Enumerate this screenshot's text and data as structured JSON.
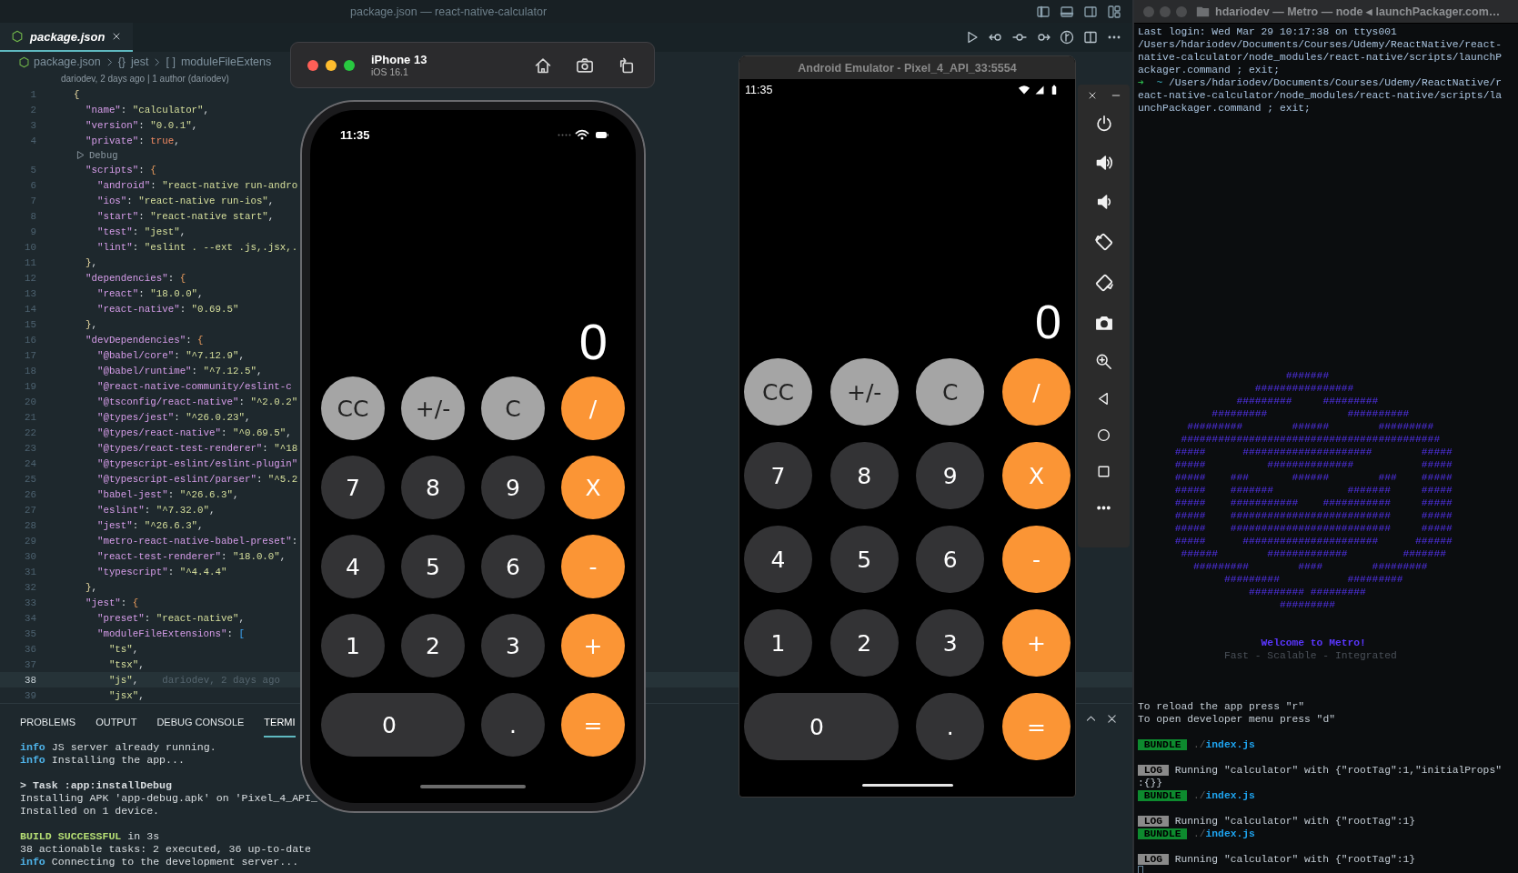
{
  "vscode": {
    "title": "package.json — react-native-calculator",
    "tab": {
      "label": "package.json"
    },
    "breadcrumb": [
      {
        "kind": "file",
        "label": "package.json"
      },
      {
        "kind": "object",
        "icon": "{}",
        "label": "jest"
      },
      {
        "kind": "array",
        "icon": "[ ]",
        "label": "moduleFileExtens"
      }
    ],
    "blame": "dariodev, 2 days ago | 1 author (dariodev)",
    "lines": [
      {
        "kind": "code",
        "number": "1",
        "text": "{",
        "current": false
      },
      {
        "kind": "code",
        "number": "2",
        "text": "  \"name\": \"calculator\",",
        "current": false
      },
      {
        "kind": "code",
        "number": "3",
        "text": "  \"version\": \"0.0.1\",",
        "current": false
      },
      {
        "kind": "code",
        "number": "4",
        "text": "  \"private\": true,",
        "current": false
      },
      {
        "kind": "codelens",
        "label": "Debug"
      },
      {
        "kind": "code",
        "number": "5",
        "text": "  \"scripts\": {",
        "current": false
      },
      {
        "kind": "code",
        "number": "6",
        "text": "    \"android\": \"react-native run-andro",
        "current": false
      },
      {
        "kind": "code",
        "number": "7",
        "text": "    \"ios\": \"react-native run-ios\",",
        "current": false
      },
      {
        "kind": "code",
        "number": "8",
        "text": "    \"start\": \"react-native start\",",
        "current": false
      },
      {
        "kind": "code",
        "number": "9",
        "text": "    \"test\": \"jest\",",
        "current": false
      },
      {
        "kind": "code",
        "number": "10",
        "text": "    \"lint\": \"eslint . --ext .js,.jsx,.",
        "current": false
      },
      {
        "kind": "code",
        "number": "11",
        "text": "  },",
        "current": false
      },
      {
        "kind": "code",
        "number": "12",
        "text": "  \"dependencies\": {",
        "current": false
      },
      {
        "kind": "code",
        "number": "13",
        "text": "    \"react\": \"18.0.0\",",
        "current": false
      },
      {
        "kind": "code",
        "number": "14",
        "text": "    \"react-native\": \"0.69.5\"",
        "current": false
      },
      {
        "kind": "code",
        "number": "15",
        "text": "  },",
        "current": false
      },
      {
        "kind": "code",
        "number": "16",
        "text": "  \"devDependencies\": {",
        "current": false
      },
      {
        "kind": "code",
        "number": "17",
        "text": "    \"@babel/core\": \"^7.12.9\",",
        "current": false
      },
      {
        "kind": "code",
        "number": "18",
        "text": "    \"@babel/runtime\": \"^7.12.5\",",
        "current": false
      },
      {
        "kind": "code",
        "number": "19",
        "text": "    \"@react-native-community/eslint-c",
        "current": false
      },
      {
        "kind": "code",
        "number": "20",
        "text": "    \"@tsconfig/react-native\": \"^2.0.2\"",
        "current": false
      },
      {
        "kind": "code",
        "number": "21",
        "text": "    \"@types/jest\": \"^26.0.23\",",
        "current": false
      },
      {
        "kind": "code",
        "number": "22",
        "text": "    \"@types/react-native\": \"^0.69.5\",",
        "current": false
      },
      {
        "kind": "code",
        "number": "23",
        "text": "    \"@types/react-test-renderer\": \"^18",
        "current": false
      },
      {
        "kind": "code",
        "number": "24",
        "text": "    \"@typescript-eslint/eslint-plugin\"",
        "current": false
      },
      {
        "kind": "code",
        "number": "25",
        "text": "    \"@typescript-eslint/parser\": \"^5.2",
        "current": false
      },
      {
        "kind": "code",
        "number": "26",
        "text": "    \"babel-jest\": \"^26.6.3\",",
        "current": false
      },
      {
        "kind": "code",
        "number": "27",
        "text": "    \"eslint\": \"^7.32.0\",",
        "current": false
      },
      {
        "kind": "code",
        "number": "28",
        "text": "    \"jest\": \"^26.6.3\",",
        "current": false
      },
      {
        "kind": "code",
        "number": "29",
        "text": "    \"metro-react-native-babel-preset\":",
        "current": false
      },
      {
        "kind": "code",
        "number": "30",
        "text": "    \"react-test-renderer\": \"18.0.0\",",
        "current": false
      },
      {
        "kind": "code",
        "number": "31",
        "text": "    \"typescript\": \"^4.4.4\"",
        "current": false
      },
      {
        "kind": "code",
        "number": "32",
        "text": "  },",
        "current": false
      },
      {
        "kind": "code",
        "number": "33",
        "text": "  \"jest\": {",
        "current": false
      },
      {
        "kind": "code",
        "number": "34",
        "text": "    \"preset\": \"react-native\",",
        "current": false
      },
      {
        "kind": "code",
        "number": "35",
        "text": "    \"moduleFileExtensions\": [",
        "current": false
      },
      {
        "kind": "code",
        "number": "36",
        "text": "      \"ts\",",
        "current": false
      },
      {
        "kind": "code",
        "number": "37",
        "text": "      \"tsx\",",
        "current": false
      },
      {
        "kind": "code",
        "number": "38",
        "text": "      \"js\",",
        "current": true,
        "blame": "dariodev, 2 days ago"
      },
      {
        "kind": "code",
        "number": "39",
        "text": "      \"jsx\",",
        "current": false
      }
    ],
    "panel": {
      "tabs": [
        {
          "label": "PROBLEMS",
          "selected": false
        },
        {
          "label": "OUTPUT",
          "selected": false
        },
        {
          "label": "DEBUG CONSOLE",
          "selected": false
        },
        {
          "label": "TERMI",
          "selected": true
        }
      ],
      "terminal": [
        [
          {
            "kind": "info",
            "label": "info",
            "text": "JS server already running."
          },
          {
            "kind": "info",
            "label": "info",
            "text": "Installing the app..."
          }
        ],
        [
          {
            "kind": "bold",
            "text": "> Task :app:installDebug"
          },
          {
            "kind": "plain",
            "text": "Installing APK 'app-debug.apk' on 'Pixel_4_API_"
          },
          {
            "kind": "plain",
            "text": "Installed on 1 device."
          }
        ],
        [
          {
            "kind": "success",
            "label": "BUILD SUCCESSFUL",
            "text": "in 3s"
          },
          {
            "kind": "plain",
            "text": "38 actionable tasks: 2 executed, 36 up-to-date"
          },
          {
            "kind": "info",
            "label": "info",
            "text": "Connecting to the development server..."
          }
        ]
      ]
    }
  },
  "ios_simulator": {
    "device": "iPhone 13",
    "os": "iOS 16.1",
    "status": {
      "time": "11:35"
    },
    "calculator": {
      "display": "0",
      "buttons": [
        {
          "kind": "function",
          "label": "CC"
        },
        {
          "kind": "function",
          "label": "+/-"
        },
        {
          "kind": "function",
          "label": "C"
        },
        {
          "kind": "operator",
          "label": "/"
        },
        {
          "kind": "digit",
          "label": "7"
        },
        {
          "kind": "digit",
          "label": "8"
        },
        {
          "kind": "digit",
          "label": "9"
        },
        {
          "kind": "operator",
          "label": "X"
        },
        {
          "kind": "digit",
          "label": "4"
        },
        {
          "kind": "digit",
          "label": "5"
        },
        {
          "kind": "digit",
          "label": "6"
        },
        {
          "kind": "operator",
          "label": "-"
        },
        {
          "kind": "digit",
          "label": "1"
        },
        {
          "kind": "digit",
          "label": "2"
        },
        {
          "kind": "digit",
          "label": "3"
        },
        {
          "kind": "operator",
          "label": "+"
        },
        {
          "kind": "wide",
          "label": "0"
        },
        {
          "kind": "digit",
          "label": "."
        },
        {
          "kind": "operator",
          "label": "="
        }
      ]
    }
  },
  "android_emulator": {
    "title": "Android Emulator - Pixel_4_API_33:5554",
    "status": {
      "time": "11:35"
    },
    "calculator": {
      "display": "0",
      "buttons": [
        {
          "kind": "function",
          "label": "CC"
        },
        {
          "kind": "function",
          "label": "+/-"
        },
        {
          "kind": "function",
          "label": "C"
        },
        {
          "kind": "operator",
          "label": "/"
        },
        {
          "kind": "digit",
          "label": "7"
        },
        {
          "kind": "digit",
          "label": "8"
        },
        {
          "kind": "digit",
          "label": "9"
        },
        {
          "kind": "operator",
          "label": "X"
        },
        {
          "kind": "digit",
          "label": "4"
        },
        {
          "kind": "digit",
          "label": "5"
        },
        {
          "kind": "digit",
          "label": "6"
        },
        {
          "kind": "operator",
          "label": "-"
        },
        {
          "kind": "digit",
          "label": "1"
        },
        {
          "kind": "digit",
          "label": "2"
        },
        {
          "kind": "digit",
          "label": "3"
        },
        {
          "kind": "operator",
          "label": "+"
        },
        {
          "kind": "wide",
          "label": "0"
        },
        {
          "kind": "digit",
          "label": "."
        },
        {
          "kind": "operator",
          "label": "="
        }
      ]
    }
  },
  "metro": {
    "title": "hdariodev — Metro — node ◂ launchPackager.com…",
    "login": [
      {
        "kind": "plain",
        "text": "Last login: Wed Mar 29 10:17:38 on ttys001"
      },
      {
        "kind": "plain",
        "text": "/Users/hdariodev/Documents/Courses/Udemy/ReactNative/react-"
      },
      {
        "kind": "plain",
        "text": "native-calculator/node_modules/react-native/scripts/launchP"
      },
      {
        "kind": "plain",
        "text": "ackager.command ; exit;"
      },
      {
        "kind": "prompt",
        "arrow": "➜",
        "cwd": "~",
        "text": "/Users/hdariodev/Documents/Courses/Udemy/ReactNative/r"
      },
      {
        "kind": "plain",
        "text": "eact-native-calculator/node_modules/react-native/scripts/la"
      },
      {
        "kind": "plain",
        "text": "unchPackager.command ; exit;"
      }
    ],
    "art": [
      "                        #######",
      "                   ################",
      "                #########     #########",
      "            #########             ##########",
      "        #########        ######        #########",
      "       ##########################################",
      "      #####      #####################        #####",
      "      #####          ##############           #####",
      "      #####    ###       ######        ###    #####",
      "      #####    #######            #######     #####",
      "      #####    ###########    ###########     #####",
      "      #####    ##########################     #####",
      "      #####    ##########################     #####",
      "      #####      ######################      ######",
      "       ######        #############         #######",
      "         #########        ####        #########",
      "              #########           #########",
      "                  ######### #########",
      "                       #########"
    ],
    "welcome": "Welcome to Metro!",
    "tagline": "Fast - Scalable - Integrated",
    "log": [
      [
        {
          "kind": "plain",
          "text": "To reload the app press \"r\""
        },
        {
          "kind": "plain",
          "text": "To open developer menu press \"d\""
        }
      ],
      [
        {
          "kind": "bundle",
          "badge": "BUNDLE",
          "prefix": "./",
          "file": "index.js"
        }
      ],
      [
        {
          "kind": "log",
          "badge": "LOG",
          "text": "Running \"calculator\" with {\"rootTag\":1,\"initialProps\""
        },
        {
          "kind": "plain",
          "text": ":{}}"
        },
        {
          "kind": "bundle",
          "badge": "BUNDLE",
          "prefix": "./",
          "file": "index.js"
        }
      ],
      [
        {
          "kind": "log",
          "badge": "LOG",
          "text": "Running \"calculator\" with {\"rootTag\":1}"
        },
        {
          "kind": "bundle",
          "badge": "BUNDLE",
          "prefix": "./",
          "file": "index.js"
        }
      ],
      [
        {
          "kind": "log",
          "badge": "LOG",
          "text": "Running \"calculator\" with {\"rootTag\":1}"
        }
      ]
    ]
  }
}
